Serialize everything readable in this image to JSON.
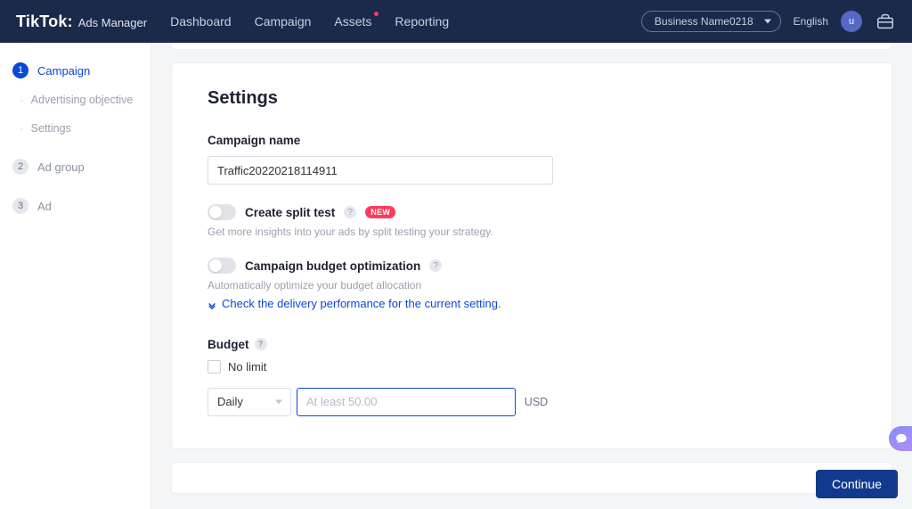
{
  "header": {
    "brand_a": "TikTok:",
    "brand_b": "Ads Manager",
    "nav": [
      "Dashboard",
      "Campaign",
      "Assets",
      "Reporting"
    ],
    "business": "Business Name0218",
    "language": "English",
    "avatar_letter": "u"
  },
  "sidebar": {
    "step1": {
      "num": "1",
      "label": "Campaign"
    },
    "sub1": "Advertising objective",
    "sub2": "Settings",
    "step2": {
      "num": "2",
      "label": "Ad group"
    },
    "step3": {
      "num": "3",
      "label": "Ad"
    }
  },
  "settings": {
    "title": "Settings",
    "campaign_name_label": "Campaign name",
    "campaign_name_value": "Traffic20220218114911",
    "split_test_label": "Create split test",
    "badge_new": "NEW",
    "split_test_hint": "Get more insights into your ads by split testing your strategy.",
    "cbo_label": "Campaign budget optimization",
    "cbo_hint": "Automatically optimize your budget allocation",
    "cbo_link": "Check the delivery performance for the current setting.",
    "budget_label": "Budget",
    "no_limit_label": "No limit",
    "interval_selected": "Daily",
    "amount_placeholder": "At least 50.00",
    "currency": "USD"
  },
  "footer": {
    "continue": "Continue"
  }
}
